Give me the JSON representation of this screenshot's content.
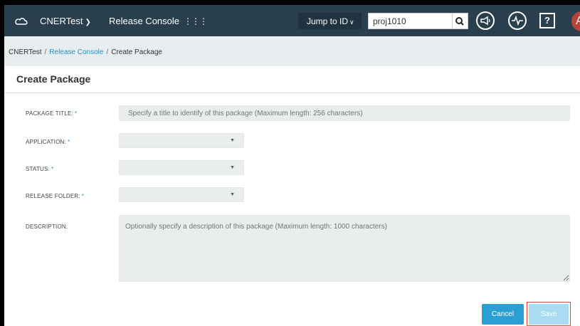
{
  "topbar": {
    "app_name": "CNERTest",
    "console_name": "Release Console",
    "jump_label": "Jump to ID",
    "search_value": "proj1010",
    "avatar_initial": "A",
    "help_glyph": "?"
  },
  "breadcrumb": {
    "root": "CNERTest",
    "section": "Release Console",
    "current": "Create Package",
    "separator": "/"
  },
  "page": {
    "title": "Create Package"
  },
  "form": {
    "package_title": {
      "label": "PACKAGE TITLE:",
      "required_mark": "*",
      "placeholder": "Specify a title to identify of this package (Maximum length: 256 characters)",
      "value": ""
    },
    "application": {
      "label": "APPLICATION:",
      "required_mark": "*",
      "value": ""
    },
    "status": {
      "label": "STATUS:",
      "required_mark": "*",
      "value": ""
    },
    "release_folder": {
      "label": "RELEASE FOLDER:",
      "required_mark": "*",
      "value": ""
    },
    "description": {
      "label": "DESCRIPTION:",
      "placeholder": "Optionally specify a description of this package (Maximum length: 1000 characters)",
      "value": ""
    }
  },
  "actions": {
    "cancel_label": "Cancel",
    "save_label": "Save"
  },
  "colors": {
    "topbar_bg": "#293f4e",
    "accent": "#2a9fd6",
    "save_disabled": "#a9dbf2",
    "highlight": "#d94b3d",
    "avatar_bg": "#b7433b"
  },
  "icons": {
    "logo": "cloud-logo-icon",
    "app_dropdown": "chevron-down-icon",
    "apps_grid": "grid-icon",
    "jump_dropdown": "chevron-down-icon",
    "search": "search-icon",
    "announcements": "megaphone-icon",
    "activity": "pulse-icon",
    "help": "help-icon",
    "select_arrow": "caret-down-icon"
  }
}
